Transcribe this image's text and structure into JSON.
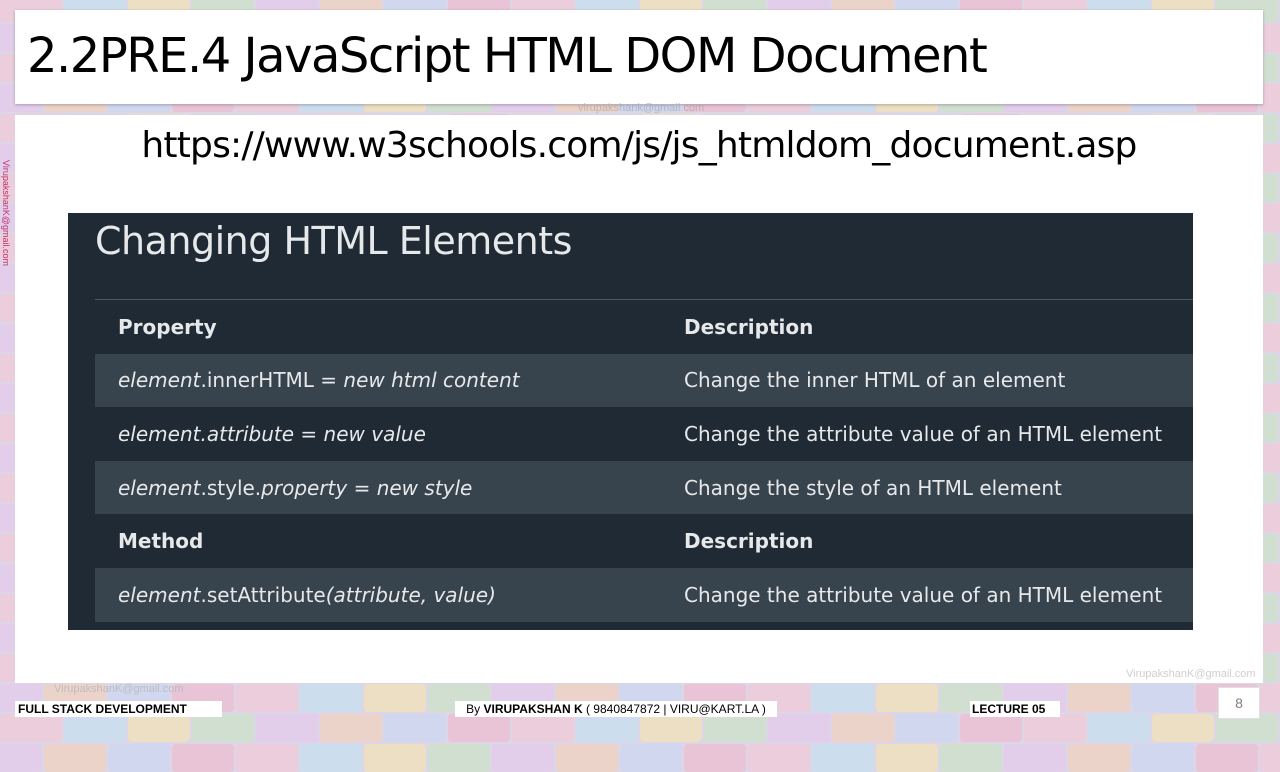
{
  "slide": {
    "title": "2.2PRE.4 JavaScript HTML DOM Document",
    "url": "https://www.w3schools.com/js/js_htmldom_document.asp",
    "page_number": "8"
  },
  "screenshot": {
    "heading": "Changing HTML Elements",
    "property_header": "Property",
    "description_header": "Description",
    "rows": [
      {
        "code_italic": "element",
        "code_rest": ".innerHTML =  ",
        "code_tail_italic": "new html content",
        "description": "Change the inner HTML of an element"
      },
      {
        "code_italic": "element",
        "code_rest": ".attribute = new value",
        "code_tail_italic": "",
        "description": "Change the attribute value of an HTML element"
      },
      {
        "code_italic": "element",
        "code_rest": ".style.",
        "code_tail_italic": "property = new style",
        "description": "Change the style of an HTML element"
      }
    ],
    "method_header": "Method",
    "method_description_header": "Description",
    "method_rows": [
      {
        "code_italic": "element",
        "code_rest": ".setAttribute",
        "code_tail_italic": "(attribute, value)",
        "description": "Change the attribute value of an HTML element"
      }
    ]
  },
  "watermarks": {
    "email": "VirupakshanK@gmail.com",
    "email_lower": "virupakshank@gmail.com"
  },
  "footer": {
    "course": "FULL STACK DEVELOPMENT",
    "by_prefix": "By ",
    "author": "VIRUPAKSHAN K",
    "contact": " ( 9840847872 | VIRU@KART.LA )",
    "lecture": "LECTURE 05"
  },
  "colors": {
    "screenshot_dark": "#1f2a34",
    "screenshot_row_light": "#38444d",
    "screenshot_text": "#e6e8ea"
  }
}
